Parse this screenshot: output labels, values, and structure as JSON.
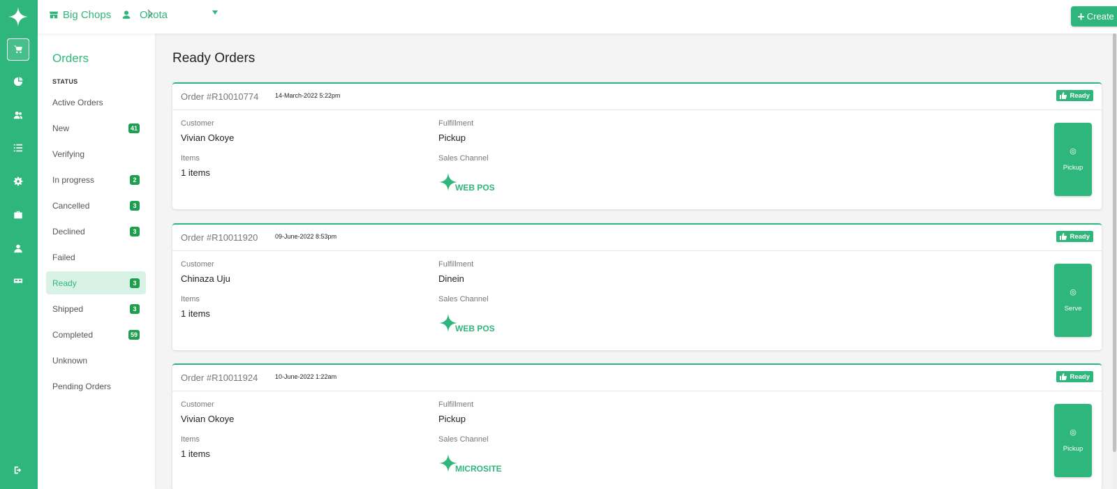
{
  "header": {
    "store": "Big Chops",
    "location": "Okota",
    "create_label": "Create order"
  },
  "sidebar": {
    "title": "Orders",
    "status_label": "STATUS",
    "items": [
      {
        "label": "Active Orders",
        "count": ""
      },
      {
        "label": "New",
        "count": "41"
      },
      {
        "label": "Verifying",
        "count": ""
      },
      {
        "label": "In progress",
        "count": "2"
      },
      {
        "label": "Cancelled",
        "count": "3"
      },
      {
        "label": "Declined",
        "count": "3"
      },
      {
        "label": "Failed",
        "count": ""
      },
      {
        "label": "Ready",
        "count": "3"
      },
      {
        "label": "Shipped",
        "count": "3"
      },
      {
        "label": "Completed",
        "count": "59"
      },
      {
        "label": "Unknown",
        "count": ""
      },
      {
        "label": "Pending Orders",
        "count": ""
      }
    ]
  },
  "main": {
    "title": "Ready Orders",
    "labels": {
      "customer": "Customer",
      "fulfillment": "Fulfillment",
      "items": "Items",
      "sales_channel": "Sales Channel"
    },
    "orders": [
      {
        "order_no": "Order #R10010774",
        "date": "14-March-2022 5:22pm",
        "status": "Ready",
        "customer": "Vivian Okoye",
        "items": "1 items",
        "fulfillment": "Pickup",
        "channel": "WEB POS",
        "action": "Pickup"
      },
      {
        "order_no": "Order #R10011920",
        "date": "09-June-2022 8:53pm",
        "status": "Ready",
        "customer": "Chinaza Uju",
        "items": "1 items",
        "fulfillment": "Dinein",
        "channel": "WEB POS",
        "action": "Serve"
      },
      {
        "order_no": "Order #R10011924",
        "date": "10-June-2022 1:22am",
        "status": "Ready",
        "customer": "Vivian Okoye",
        "items": "1 items",
        "fulfillment": "Pickup",
        "channel": "MICROSITE",
        "action": "Pickup"
      }
    ]
  },
  "rail": {
    "icons": [
      "logo-icon",
      "cart-icon",
      "pie-chart-icon",
      "users-icon",
      "list-icon",
      "gear-icon",
      "briefcase-icon",
      "user-icon",
      "truck-icon",
      "logout-icon"
    ]
  },
  "colors": {
    "brand": "#2fb67c",
    "badge": "#1f9e4f",
    "active_bg": "#d8f3e6"
  }
}
